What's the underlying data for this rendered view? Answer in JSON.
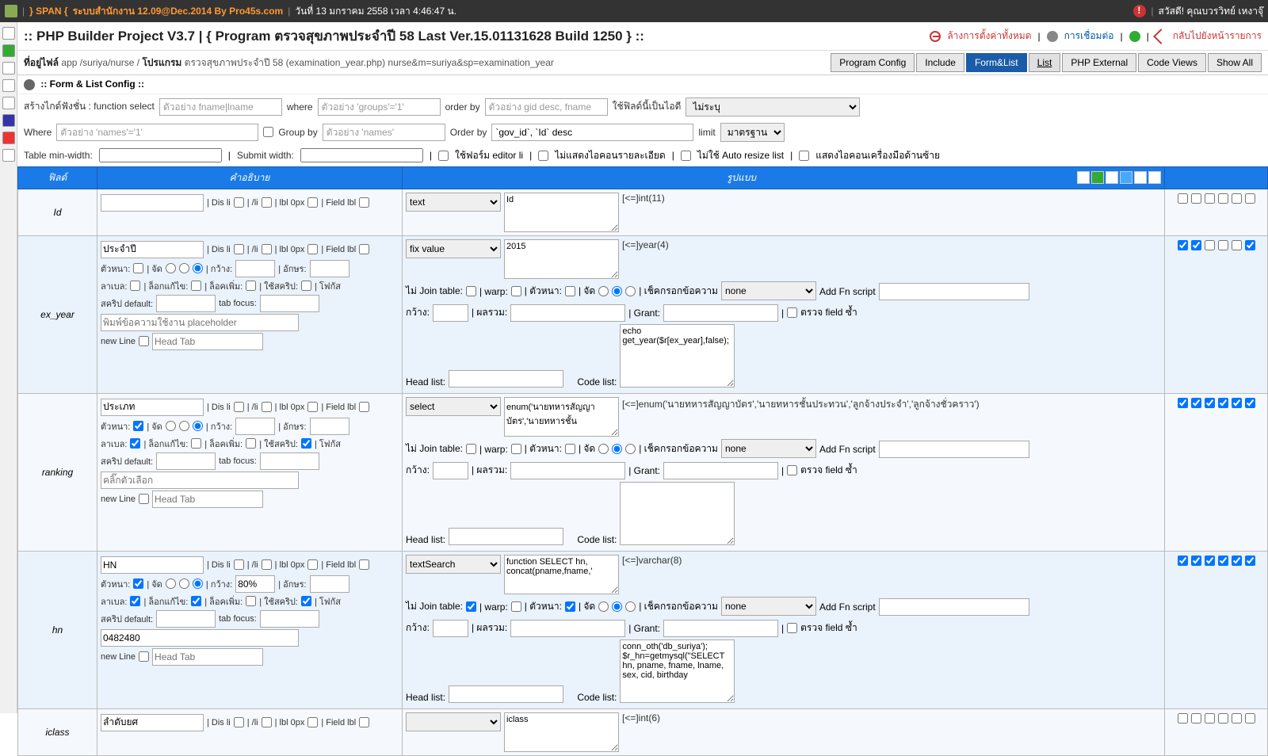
{
  "topbar": {
    "span": "} SPAN {",
    "system": "ระบบสำนักงาน 12.09@Dec.2014 By Pro45s.com",
    "date": "วันที่ 13 มกราคม 2558 เวลา 4:46:47 น.",
    "greeting": "สวัสดี! คุณบวรวิทย์ เหงาจุ๊"
  },
  "title": {
    "text": ":: PHP Builder Project V3.7 | { Program ตรวจสุขภาพประจำปี 58 Last Ver.15.01131628 Build 1250 } ::",
    "clear": "ล้างการตั้งค่าทั้งหมด",
    "connect": "การเชื่อมต่อ",
    "back": "กลับไปยังหน้ารายการ"
  },
  "path": {
    "label": "ที่อยู่ไฟล์",
    "app": "app /suriya/nurse /",
    "prog_label": "โปรแกรม",
    "prog": "ตรวจสุขภาพประจำปี 58 (examination_year.php) nurse&m=suriya&sp=examination_year"
  },
  "tabs": {
    "config": "Program Config",
    "include": "Include",
    "formlist": "Form&List",
    "list": "List",
    "external": "PHP External",
    "code": "Code Views",
    "showall": "Show All"
  },
  "section": ":: Form & List Config ::",
  "cfg1": {
    "label": "สร้างไกด์ฟังชั่น : function select",
    "ph1": "ตัวอย่าง fname|lname",
    "where": "where",
    "ph2": "ตัวอย่าง 'groups'='1'",
    "orderby": "order by",
    "ph3": "ตัวอย่าง gid desc, fname",
    "idlabel": "ใช้ฟิลด์นี้เป็นไอดี",
    "idval": "ไม่ระบุ"
  },
  "cfg2": {
    "where": "Where",
    "ph1": "ตัวอย่าง 'names'='1'",
    "groupby": "Group by",
    "ph2": "ตัวอย่าง 'names'",
    "orderby": "Order by",
    "orderval": "`gov_id`, `Id` desc",
    "limit": "limit",
    "limitval": "มาตรฐาน"
  },
  "opts": {
    "minwidth": "Table min-width:",
    "submit": "Submit width:",
    "o1": "ใช้ฟอร์ม editor li",
    "o2": "ไม่แสดงไอคอนรายละเอียด",
    "o3": "ไม่ใช้ Auto resize list",
    "o4": "แสดงไอคอนเครื่องมือด้านซ้าย"
  },
  "headers": {
    "field": "ฟิลด์",
    "desc": "คำอธิบาย",
    "format": "รูปแบบ"
  },
  "labels": {
    "disli": "Dis li",
    "sli": "/li",
    "lbl0": "lbl 0px",
    "fieldlbl": "Field lbl",
    "bold": "ตัวหนา:",
    "align": "จัด",
    "width": "กว้าง:",
    "chars": "อักษร:",
    "label": "ลาเบล:",
    "lockedit": "ล็อกแก้ไข:",
    "lockadd": "ล็อคเพิ่ม:",
    "usescript": "ใช้สคริป:",
    "focus": "โฟกัส",
    "scriptdef": "สคริป default:",
    "tabfocus": "tab focus:",
    "phtext": "พิมพ์ข้อความใช้งาน placeholder",
    "newline": "new Line",
    "headtab": "Head Tab",
    "nojoin": "ไม่ Join table:",
    "warp": "warp:",
    "checkdata": "เช็คกรอกข้อความ",
    "addfn": "Add Fn script",
    "sum": "ผลรวม:",
    "grant": "Grant:",
    "checkdup": "ตรวจ field ซ้ำ",
    "headlist": "Head list:",
    "codelist": "Code list:",
    "none": "none"
  },
  "rows": [
    {
      "field": "Id",
      "title": "",
      "type": "text",
      "typetext": "Id",
      "typeinfo": "[<=]int(11)",
      "alt": false
    },
    {
      "field": "ex_year",
      "title": "ประจำปี",
      "type": "fix value",
      "typetext": "2015",
      "typeinfo": "[<=]year(4)",
      "code": "echo get_year($r[ex_year],false);",
      "alt": true,
      "full": true
    },
    {
      "field": "ranking",
      "title": "ประเภท",
      "type": "select",
      "typetext": "enum('นายทหารสัญญาบัตร','นายทหารชั้น",
      "typeinfo": "[<=]enum('นายทหารสัญญาบัตร','นายทหารชั้นประทวน','ลูกจ้างประจำ','ลูกจ้างชั่วคราว')",
      "placeholder": "คลิ๊กตัวเลือก",
      "alt": false,
      "full": true,
      "boldchk": true,
      "labelchk": true,
      "scriptchk": true
    },
    {
      "field": "hn",
      "title": "HN",
      "type": "textSearch",
      "typetext": "function SELECT hn, concat(pname,fname,'",
      "typeinfo": "[<=]varchar(8)",
      "widthval": "80%",
      "defval": "0482480",
      "code": "conn_oth('db_suriya');\n$r_hn=getmysql(\"SELECT hn, pname, fname, lname, sex, cid, birthday",
      "alt": true,
      "full": true,
      "boldchk": true,
      "labelchk": true,
      "lockeditchk": true,
      "scriptchk": true,
      "fboldchk": true,
      "joinchk": true
    },
    {
      "field": "iclass",
      "title": "ลำดับยศ",
      "type": "",
      "typetext": "iclass",
      "typeinfo": "[<=]int(6)",
      "alt": false,
      "partial": true
    }
  ]
}
